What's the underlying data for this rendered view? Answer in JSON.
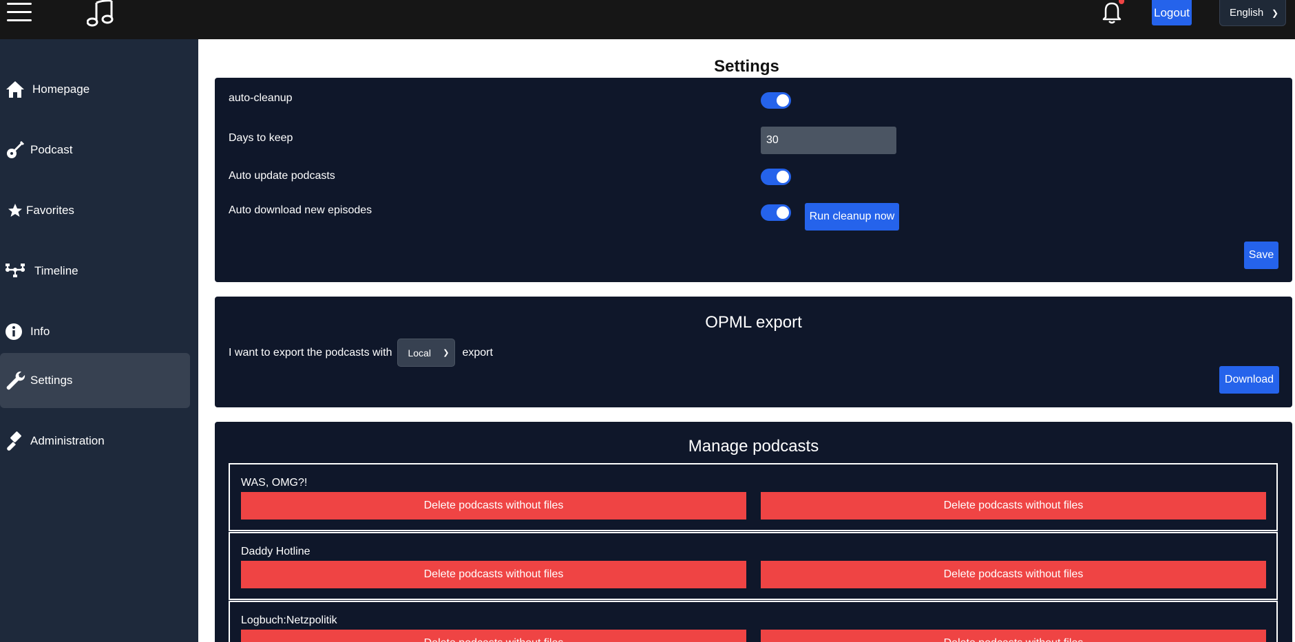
{
  "topbar": {
    "logout_label": "Logout",
    "language": "English"
  },
  "sidebar": {
    "items": [
      {
        "label": "Homepage",
        "icon": "home-icon"
      },
      {
        "label": "Podcast",
        "icon": "guitar-icon"
      },
      {
        "label": "Favorites",
        "icon": "star-icon"
      },
      {
        "label": "Timeline",
        "icon": "timeline-icon"
      },
      {
        "label": "Info",
        "icon": "info-icon"
      },
      {
        "label": "Settings",
        "icon": "wrench-icon",
        "active": true
      },
      {
        "label": "Administration",
        "icon": "gavel-icon"
      }
    ]
  },
  "settings": {
    "title": "Settings",
    "auto_cleanup_label": "auto-cleanup",
    "auto_cleanup": true,
    "days_label": "Days to keep",
    "days_value": "30",
    "auto_update_label": "Auto update podcasts",
    "auto_update": true,
    "auto_download_label": "Auto download new episodes",
    "auto_download": true,
    "run_cleanup_label": "Run cleanup now",
    "save_label": "Save"
  },
  "opml": {
    "title": "OPML export",
    "prefix": "I want to export the podcasts with",
    "selected": "Local",
    "suffix": "export",
    "download_label": "Download"
  },
  "manage": {
    "title": "Manage podcasts",
    "podcasts": [
      {
        "name": "WAS, OMG?!",
        "left_btn": "Delete podcasts without files",
        "right_btn": "Delete podcasts without files"
      },
      {
        "name": "Daddy Hotline",
        "left_btn": "Delete podcasts without files",
        "right_btn": "Delete podcasts without files"
      },
      {
        "name": "Logbuch:Netzpolitik",
        "left_btn": "Delete podcasts without files",
        "right_btn": "Delete podcasts without files"
      }
    ]
  },
  "colors": {
    "topbar": "#161616",
    "sidebar": "#1e293b",
    "card": "#0f172a",
    "accent": "#2563eb",
    "danger": "#ef4444"
  }
}
